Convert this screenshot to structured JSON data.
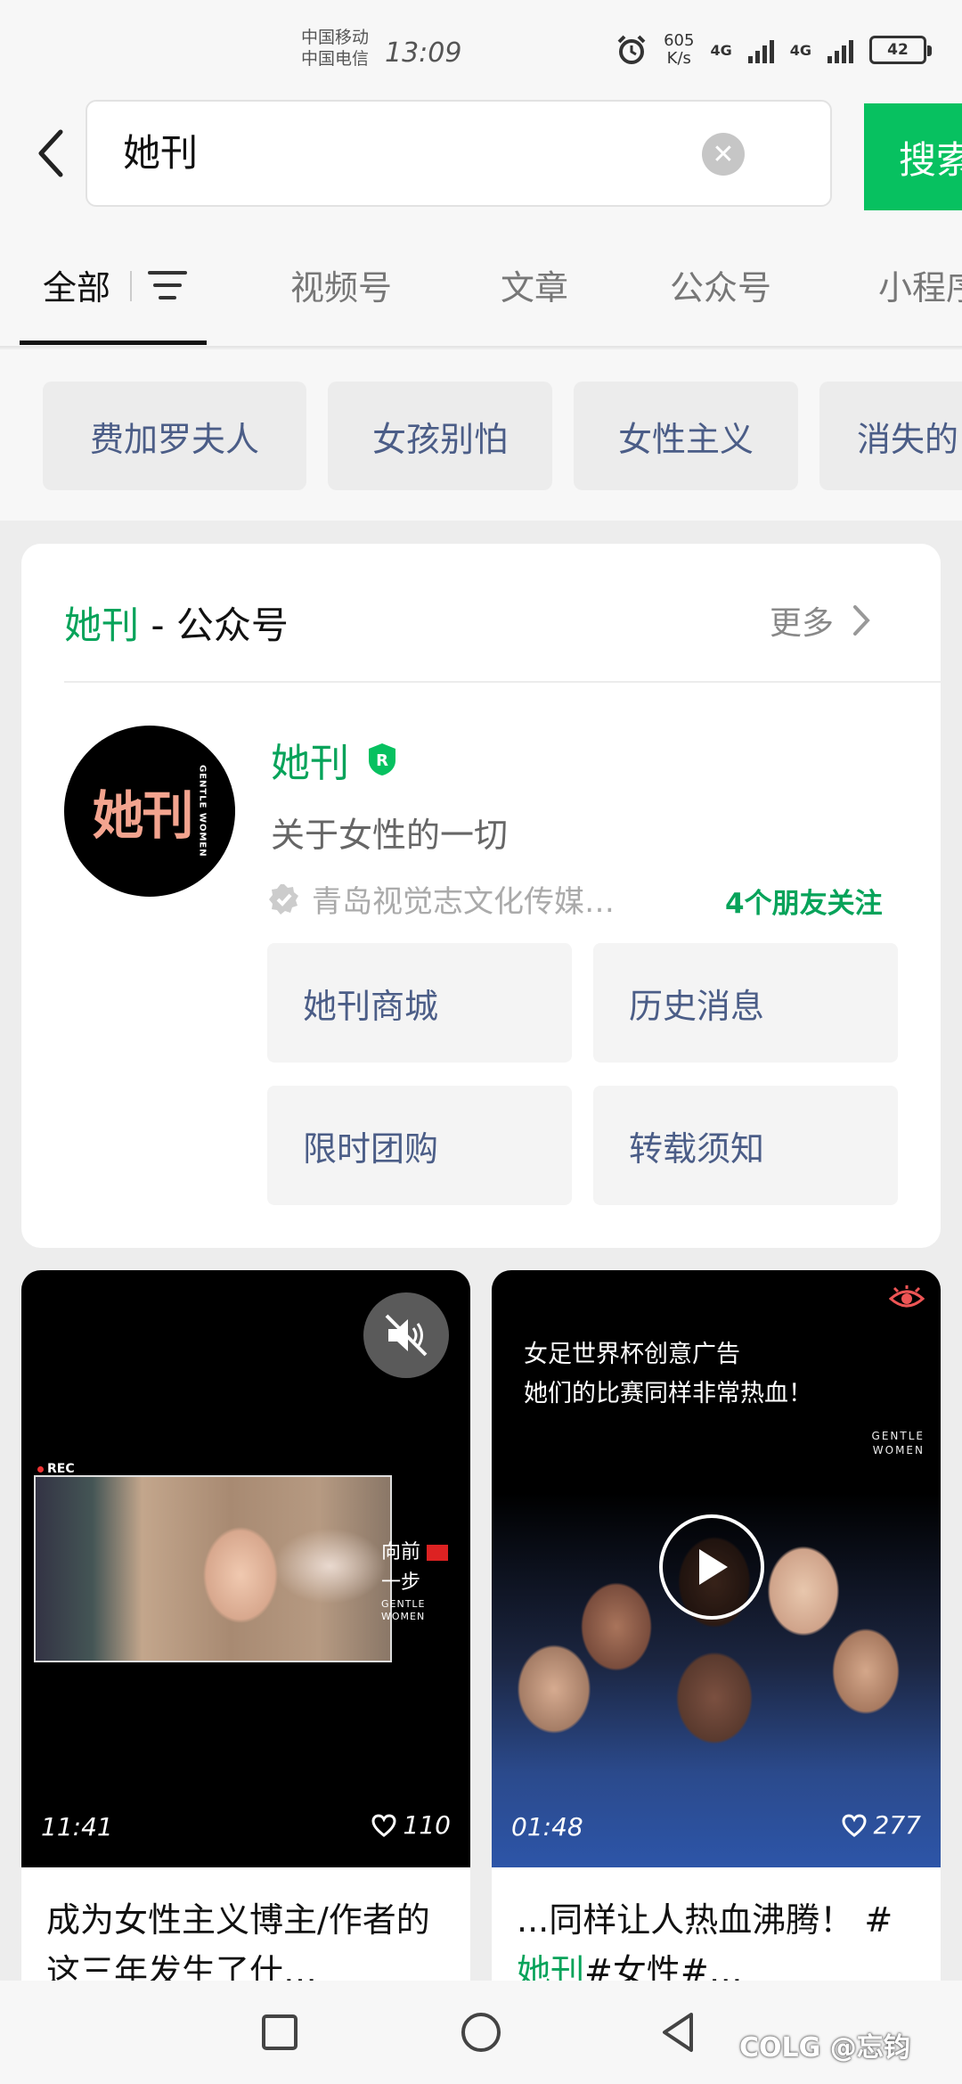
{
  "status_bar": {
    "carrier_1": "中国移动",
    "carrier_2": "中国电信",
    "time": "13:09",
    "net_speed_value": "605",
    "net_speed_unit": "K/s",
    "signal_1": "4G",
    "signal_2": "4G",
    "battery": "42"
  },
  "search": {
    "query": "她刊",
    "button_label": "搜索"
  },
  "tabs": [
    {
      "label": "全部",
      "active": true
    },
    {
      "label": "视频号"
    },
    {
      "label": "文章"
    },
    {
      "label": "公众号"
    },
    {
      "label": "小程序"
    }
  ],
  "suggestions": [
    "费加罗夫人",
    "女孩别怕",
    "女性主义",
    "消失的"
  ],
  "account_section": {
    "heading_keyword": "她刊",
    "heading_suffix": " - 公众号",
    "more_label": "更多",
    "account": {
      "name": "她刊",
      "verified_badge": "R",
      "description": "关于女性的一切",
      "organization": "青岛视觉志文化传媒…",
      "friends_following": "4个朋友关注",
      "avatar_text": "她刊",
      "avatar_subtext": "GENTLE WOMEN"
    },
    "menu": [
      "她刊商城",
      "历史消息",
      "限时团购",
      "转载须知"
    ]
  },
  "videos": [
    {
      "duration": "11:41",
      "likes": "110",
      "rec_label": "REC",
      "side_text_1": "向前",
      "side_text_2": "一步",
      "side_text_small": "GENTLE WOMEN",
      "title": "成为女性主义博主/作者的这三年发生了什…"
    },
    {
      "duration": "01:48",
      "likes": "277",
      "overlay_line_1": "女足世界杯创意广告",
      "overlay_line_2": "她们的比赛同样非常热血！",
      "logo_text_1": "GENTLE",
      "logo_text_2": "WOMEN",
      "title_prefix": "...同样让人热血沸腾！ #",
      "title_keyword": "她刊",
      "title_suffix": "#女性#…"
    }
  ],
  "watermark": "COLG @忘钧",
  "colors": {
    "accent_green": "#07c160",
    "link_blue": "#4b5d87"
  }
}
